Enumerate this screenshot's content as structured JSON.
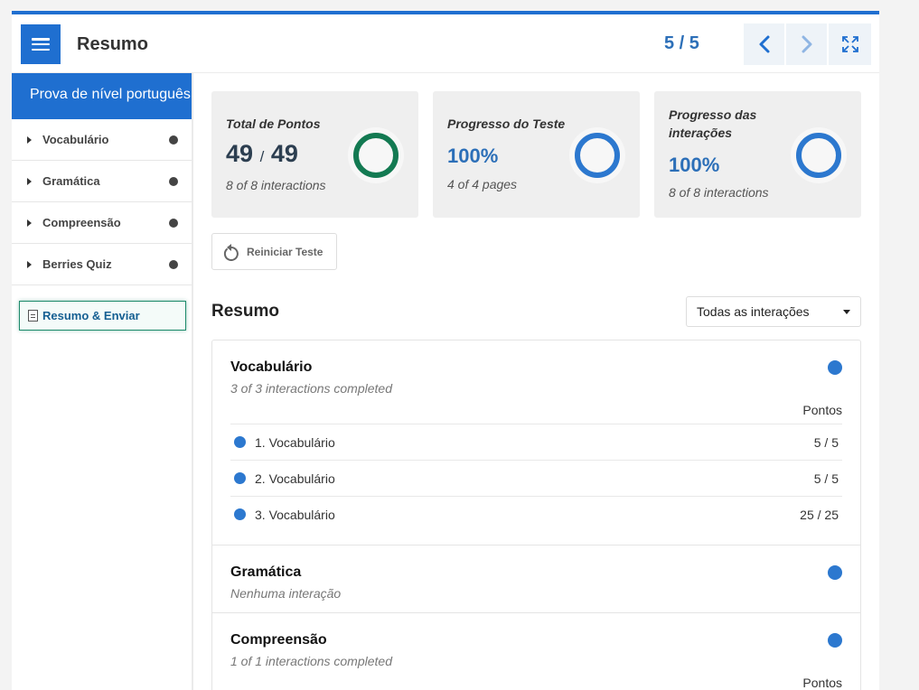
{
  "header": {
    "title": "Resumo",
    "counter": "5 / 5"
  },
  "sidebar": {
    "title": "Prova de nível português",
    "items": [
      {
        "label": "Vocabulário"
      },
      {
        "label": "Gramática"
      },
      {
        "label": "Compreensão"
      },
      {
        "label": "Berries Quiz"
      }
    ],
    "summary_label": "Resumo & Enviar"
  },
  "cards": {
    "points": {
      "label": "Total de Pontos",
      "score": "49",
      "separator": "/",
      "total": "49",
      "sub": "8 of 8 interactions",
      "progress": 1.0,
      "color": "#137a52"
    },
    "test": {
      "label": "Progresso do Teste",
      "value": "100%",
      "sub": "4 of 4 pages",
      "progress": 1.0,
      "color": "#2c78cf"
    },
    "interactions": {
      "label_line1": "Progresso das",
      "label_line2": "interações",
      "value": "100%",
      "sub": "8 of 8 interactions",
      "progress": 1.0,
      "color": "#2c78cf"
    }
  },
  "reset_label": "Reiniciar Teste",
  "summary": {
    "heading": "Resumo",
    "filter_value": "Todas as interações",
    "sections": [
      {
        "title": "Vocabulário",
        "subtitle": "3 of 3 interactions completed",
        "points_header": "Pontos",
        "rows": [
          {
            "label": "1. Vocabulário",
            "score": "5 / 5"
          },
          {
            "label": "2. Vocabulário",
            "score": "5 / 5"
          },
          {
            "label": "3. Vocabulário",
            "score": "25 / 25"
          }
        ]
      },
      {
        "title": "Gramática",
        "subtitle": "Nenhuma interação"
      },
      {
        "title": "Compreensão",
        "subtitle": "1 of 1 interactions completed",
        "points_header": "Pontos"
      }
    ]
  },
  "colors": {
    "accent": "#1f6fd0",
    "status_dot": "#2c78cf",
    "summary_border": "#1d8a6b"
  }
}
